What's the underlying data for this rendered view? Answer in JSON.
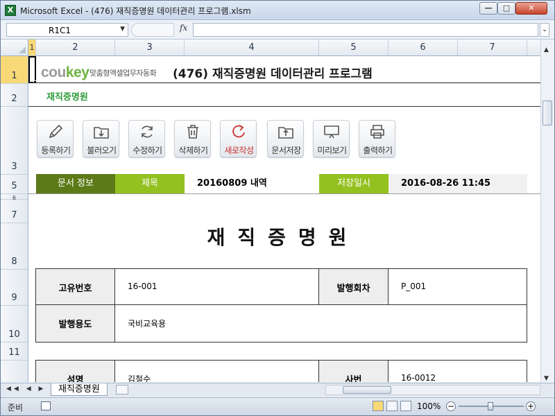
{
  "window": {
    "title": "Microsoft Excel - (476) 재직증명원 데이터관리 프로그램.xlsm",
    "app_icon": "X",
    "buttons": {
      "minimize": "—",
      "maximize": "□",
      "close": "✕"
    }
  },
  "formula_bar": {
    "name_box": "R1C1",
    "fx": "fx",
    "formula": ""
  },
  "columns": [
    "1",
    "2",
    "3",
    "4",
    "5",
    "6",
    "7"
  ],
  "rows": [
    "1",
    "2",
    "3",
    "5",
    "6",
    "7",
    "8",
    "9",
    "10",
    "11",
    "12"
  ],
  "header": {
    "logo_part1": "cou",
    "logo_part2": "key",
    "logo_tagline": "맞춤형엑셀업무자동화",
    "title": "(476) 재직증명원 데이터관리 프로그램",
    "sheet_label": "재직증명원"
  },
  "toolbar": [
    {
      "label": "등록하기",
      "icon": "pencil-icon"
    },
    {
      "label": "불러오기",
      "icon": "folder-download-icon"
    },
    {
      "label": "수정하기",
      "icon": "refresh-icon"
    },
    {
      "label": "삭제하기",
      "icon": "trash-icon"
    },
    {
      "label": "새로작성",
      "icon": "new-document-icon"
    },
    {
      "label": "문서저장",
      "icon": "folder-upload-icon"
    },
    {
      "label": "미리보기",
      "icon": "monitor-icon"
    },
    {
      "label": "출력하기",
      "icon": "printer-icon"
    }
  ],
  "info": {
    "doc_info_label": "문서 정보",
    "title_label": "제목",
    "title_value": "20160809 내역",
    "saved_label": "저장일시",
    "saved_value": "2016-08-26 11:45"
  },
  "certificate": {
    "heading": "재직증명원",
    "id_label": "고유번호",
    "id_value": "16-001",
    "issue_no_label": "발행회차",
    "issue_no_value": "P_001",
    "purpose_label": "발행용도",
    "purpose_value": "국비교육용",
    "name_label": "성명",
    "name_value": "김철수",
    "emp_no_label": "사번",
    "emp_no_value": "16-0012"
  },
  "sheet_tabs": {
    "nav": "◀◀ ◀ ▶ ▶▶",
    "active": "재직증명원"
  },
  "status": {
    "ready": "준비",
    "zoom": "100%"
  },
  "colors": {
    "accent_dark_green": "#5c7a17",
    "accent_light_green": "#93c11f",
    "sheet_label_green": "#2f9b3a",
    "new_button_red": "#c8302b"
  }
}
